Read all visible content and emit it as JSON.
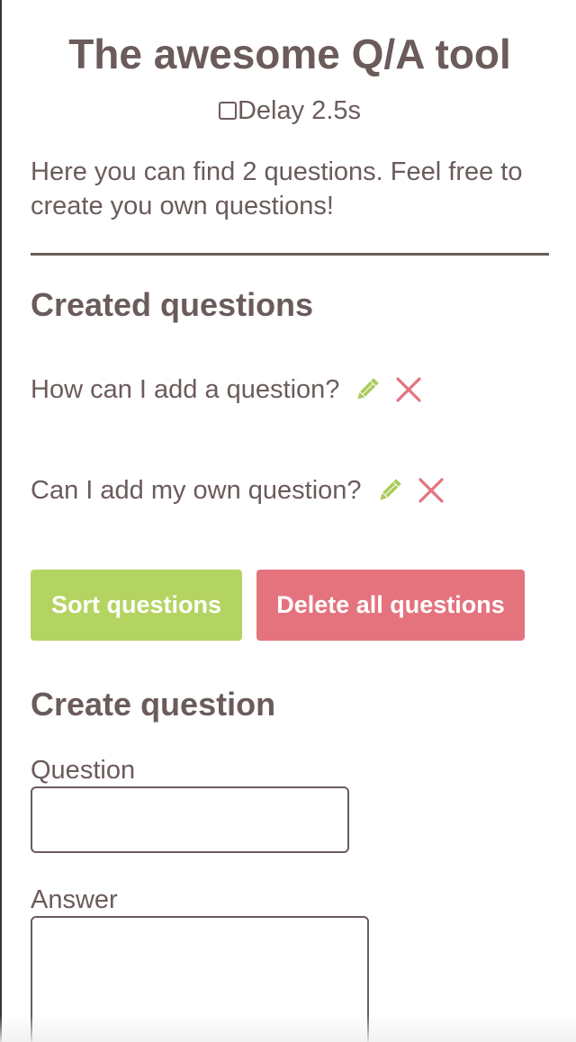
{
  "header": {
    "title": "The awesome Q/A tool",
    "delay_label": "Delay 2.5s",
    "delay_checked": false
  },
  "intro": "Here you can find 2 questions. Feel free to create you own questions!",
  "created": {
    "heading": "Created questions",
    "questions": [
      {
        "text": "How can I add a question?",
        "edit_icon": "pencil-icon",
        "delete_icon": "close-icon"
      },
      {
        "text": "Can I add my own question?",
        "edit_icon": "pencil-icon",
        "delete_icon": "close-icon"
      }
    ]
  },
  "actions": {
    "sort_label": "Sort questions",
    "delete_all_label": "Delete all questions"
  },
  "create": {
    "heading": "Create question",
    "question_label": "Question",
    "question_value": "",
    "answer_label": "Answer",
    "answer_value": ""
  },
  "colors": {
    "text": "#6b5b5b",
    "sort_button": "#b4d462",
    "delete_button": "#e4737e",
    "edit_icon": "#a8cc5a",
    "delete_icon": "#e4737e"
  }
}
